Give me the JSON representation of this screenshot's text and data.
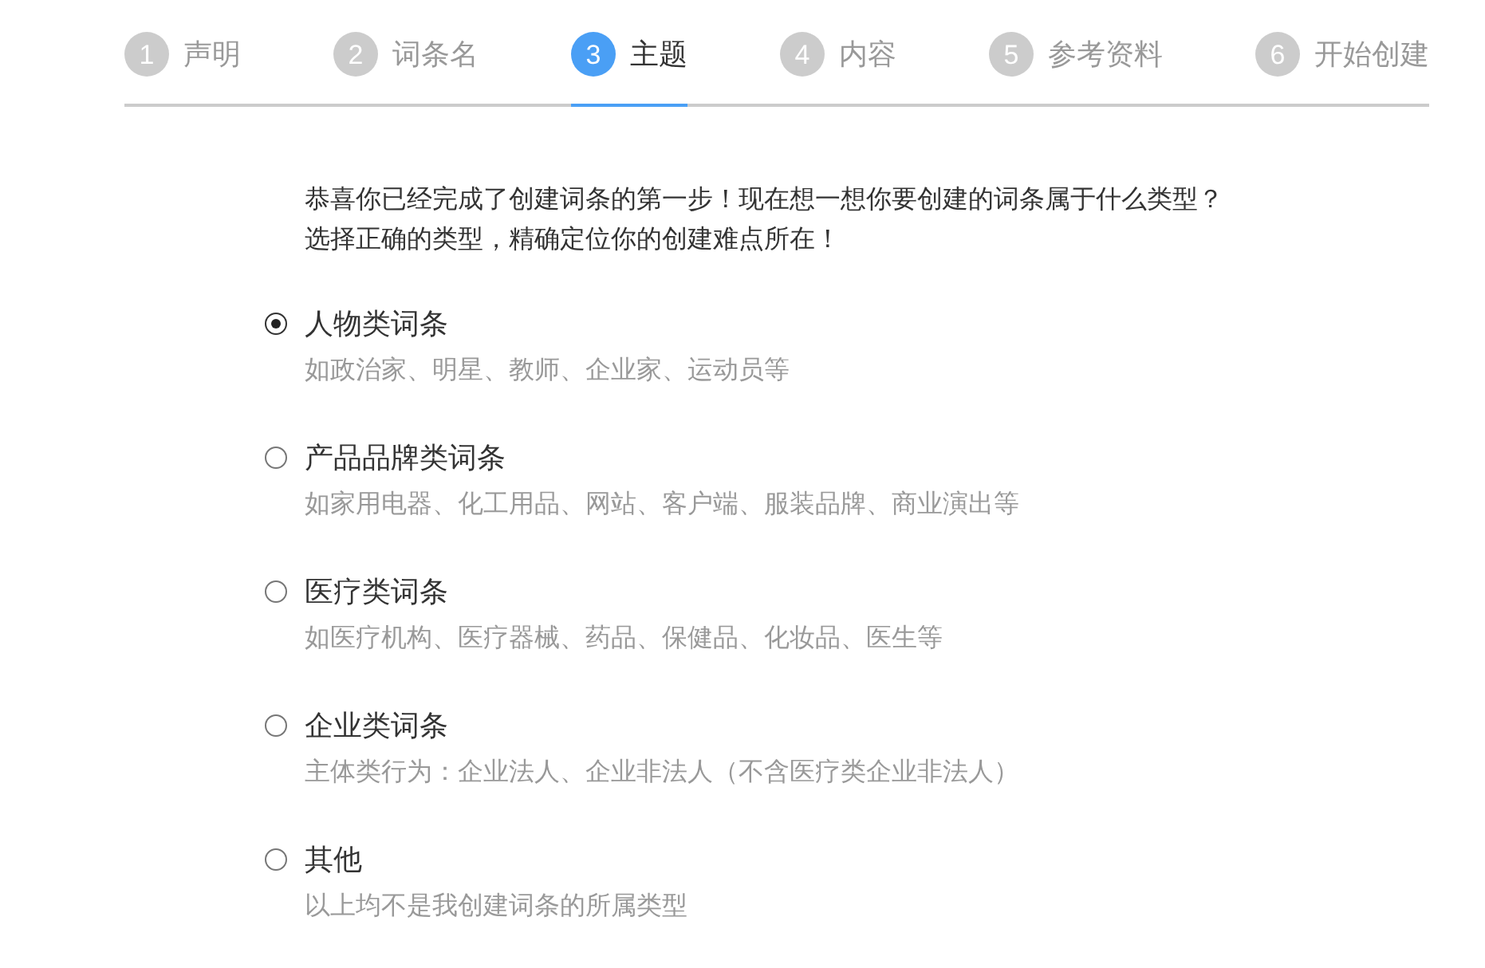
{
  "steps": [
    {
      "number": "1",
      "label": "声明",
      "selected": false
    },
    {
      "number": "2",
      "label": "词条名",
      "selected": false
    },
    {
      "number": "3",
      "label": "主题",
      "selected": true
    },
    {
      "number": "4",
      "label": "内容",
      "selected": false
    },
    {
      "number": "5",
      "label": "参考资料",
      "selected": false
    },
    {
      "number": "6",
      "label": "开始创建",
      "selected": false
    }
  ],
  "intro": [
    "恭喜你已经完成了创建词条的第一步！现在想一想你要创建的词条属于什么类型？",
    "选择正确的类型，精确定位你的创建难点所在！"
  ],
  "options": [
    {
      "label": "人物类词条",
      "description": "如政治家、明星、教师、企业家、运动员等",
      "selected": true
    },
    {
      "label": "产品品牌类词条",
      "description": "如家用电器、化工用品、网站、客户端、服装品牌、商业演出等",
      "selected": false
    },
    {
      "label": "医疗类词条",
      "description": "如医疗机构、医疗器械、药品、保健品、化妆品、医生等",
      "selected": false
    },
    {
      "label": "企业类词条",
      "description": "主体类行为：企业法人、企业非法人（不含医疗类企业非法人）",
      "selected": false
    },
    {
      "label": "其他",
      "description": "以上均不是我创建词条的所属类型",
      "selected": false
    }
  ]
}
